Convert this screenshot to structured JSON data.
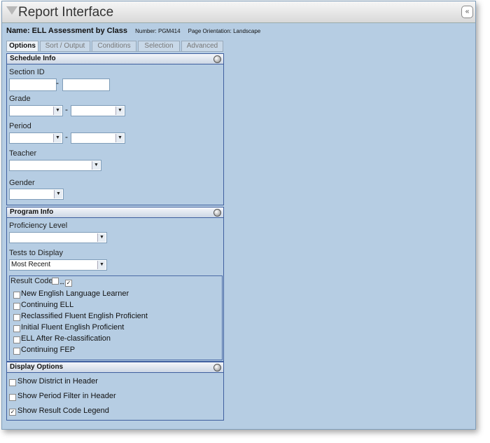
{
  "window": {
    "title": "Report Interface",
    "collapse_glyph": "«",
    "title_icon": "funnel-icon"
  },
  "report": {
    "name_label": "Name: ELL Assessment by Class",
    "number_label": "Number: PGM414",
    "orientation_label": "Page Orientation: Landscape"
  },
  "tabs": [
    {
      "label": "Options",
      "active": true
    },
    {
      "label": "Sort / Output",
      "active": false
    },
    {
      "label": "Conditions",
      "active": false
    },
    {
      "label": "Selection",
      "active": false
    },
    {
      "label": "Advanced",
      "active": false
    }
  ],
  "schedule_info": {
    "header": "Schedule Info",
    "section_id_label": "Section ID",
    "section_from": "",
    "section_to": "",
    "range_sep": "-",
    "grade_label": "Grade",
    "grade_from": "",
    "grade_to": "",
    "period_label": "Period",
    "period_from": "",
    "period_to": "",
    "teacher_label": "Teacher",
    "teacher_value": "",
    "gender_label": "Gender",
    "gender_value": ""
  },
  "program_info": {
    "header": "Program Info",
    "proficiency_label": "Proficiency Level",
    "proficiency_value": "",
    "tests_label": "Tests to Display",
    "tests_value": "Most Recent",
    "result_code_label": "Result Code",
    "result_codes": [
      {
        "label": "New English Language Learner",
        "checked": false
      },
      {
        "label": "Continuing ELL",
        "checked": false
      },
      {
        "label": "Reclassified Fluent English Proficient",
        "checked": false
      },
      {
        "label": "Initial Fluent English Proficient",
        "checked": false
      },
      {
        "label": "ELL After Re-classification",
        "checked": false
      },
      {
        "label": "Continuing FEP",
        "checked": false
      }
    ]
  },
  "display_options": {
    "header": "Display Options",
    "items": [
      {
        "label": "Show District in Header",
        "checked": false
      },
      {
        "label": "Show Period Filter in Header",
        "checked": false
      },
      {
        "label": "Show Result Code Legend",
        "checked": true
      }
    ]
  },
  "glyphs": {
    "dropdown_arrow": "▼",
    "check": "✓"
  },
  "colors": {
    "background": "#b6cde3",
    "panel_border": "#3f5f9f",
    "window_border": "#7f9db9"
  }
}
